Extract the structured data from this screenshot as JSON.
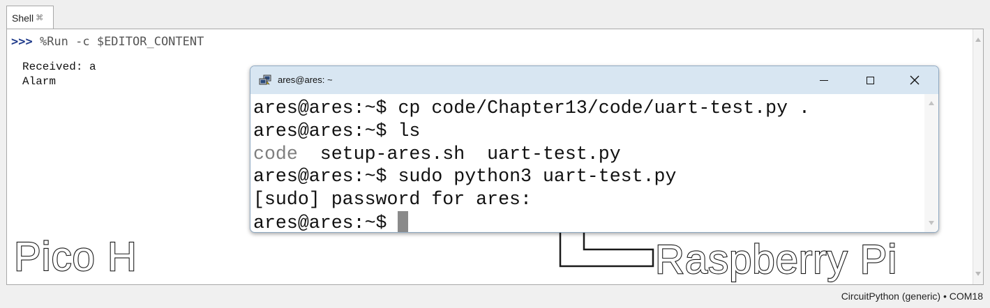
{
  "thonny": {
    "tab": {
      "label": "Shell",
      "close_icon": "close-icon"
    },
    "shell": {
      "prompt": ">>>",
      "command": " %Run -c $EDITOR_CONTENT",
      "output": [
        "Received: a",
        "Alarm"
      ]
    },
    "status": {
      "backend": "CircuitPython (generic)",
      "separator": "•",
      "port": "COM18"
    }
  },
  "terminal": {
    "title": "ares@ares: ~",
    "icon": "putty-icon",
    "buttons": {
      "minimize": "minimize-icon",
      "maximize": "maximize-icon",
      "close": "close-icon"
    },
    "lines": [
      {
        "prompt": "ares@ares:~$",
        "text": " cp code/Chapter13/code/uart-test.py ."
      },
      {
        "prompt": "ares@ares:~$",
        "text": " ls"
      },
      {
        "dir": "code",
        "files": "  setup-ares.sh  uart-test.py"
      },
      {
        "prompt": "ares@ares:~$",
        "text": " sudo python3 uart-test.py"
      },
      {
        "text": "[sudo] password for ares:"
      },
      {
        "prompt": "ares@ares:~$",
        "text": " "
      }
    ],
    "colors": {
      "directory": "#7f7f7f",
      "cursor": "#8a8a8a",
      "titlebar": "#d8e6f2"
    }
  },
  "captions": {
    "left": "Pico H",
    "right": "Raspberry Pi"
  },
  "annotation": {
    "arrow": "up-arrow"
  }
}
